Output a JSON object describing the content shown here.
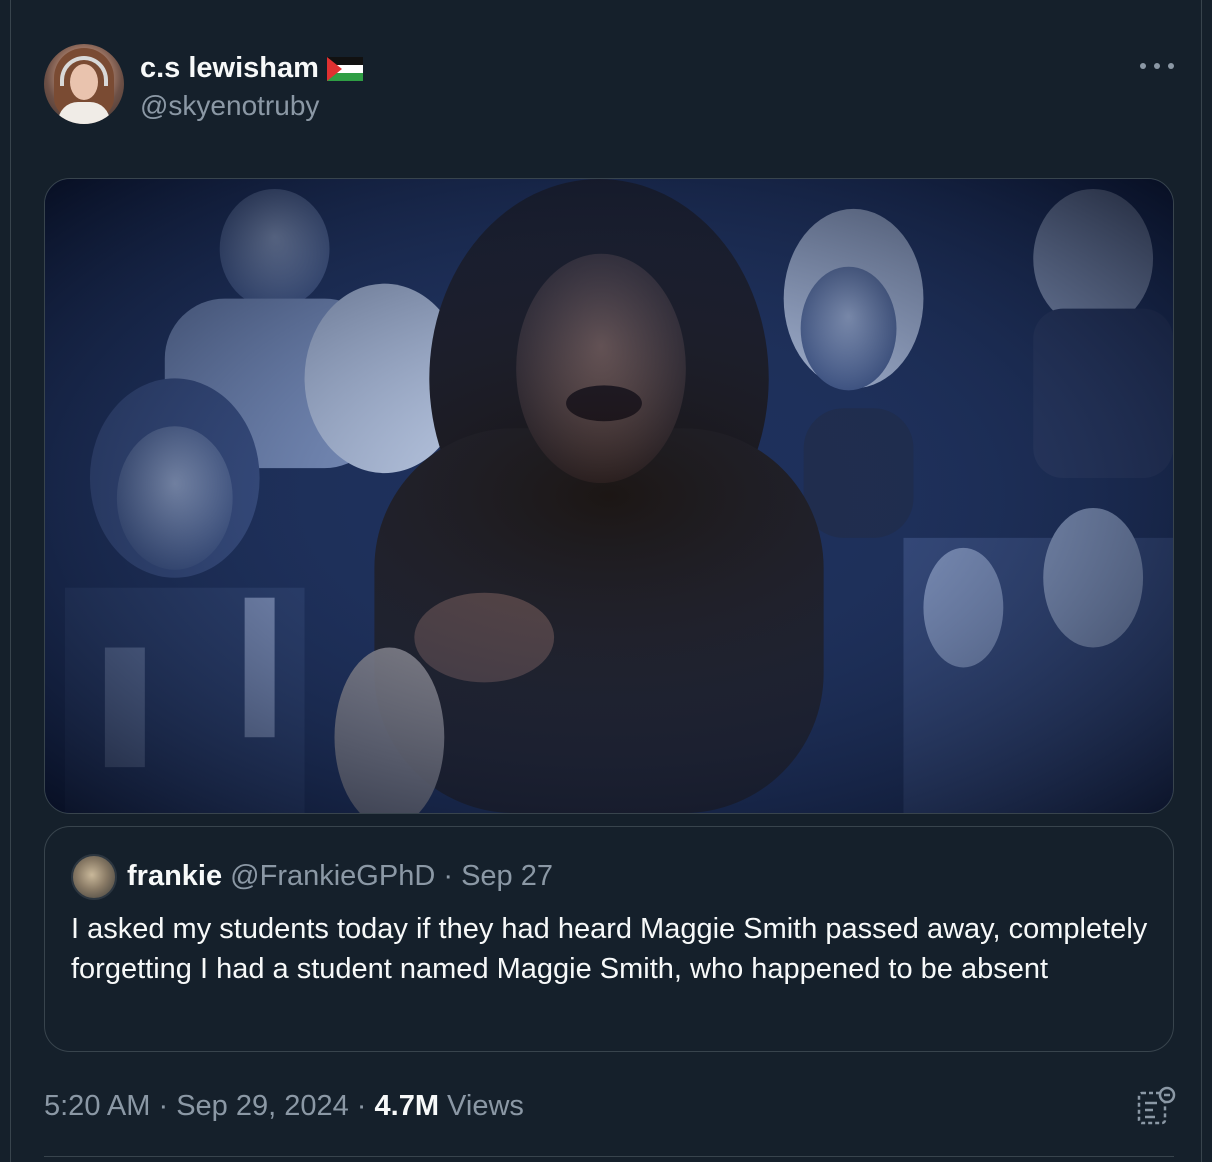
{
  "post": {
    "author": {
      "display_name": "c.s lewisham",
      "handle": "@skyenotruby",
      "flag_icon": "palestine-flag-icon"
    },
    "more_icon": "more-horizontal-icon",
    "media": {
      "alt": ""
    },
    "quote": {
      "author_name": "frankie",
      "author_handle": "@FrankieGPhD",
      "separator": " · ",
      "date": "Sep 27",
      "text": "I asked my students today if they had heard Maggie Smith passed away, completely forgetting I had a student named Maggie Smith, who happened to be absent"
    },
    "time": "5:20 AM",
    "date": "Sep 29, 2024",
    "dot": " · ",
    "views_count": "4.7M",
    "views_label": " Views",
    "analytics_icon": "analytics-icon"
  },
  "colors": {
    "background": "#15202b",
    "border": "#38444d",
    "secondary_text": "#8b98a5",
    "primary_text": "#f7f9f9"
  }
}
